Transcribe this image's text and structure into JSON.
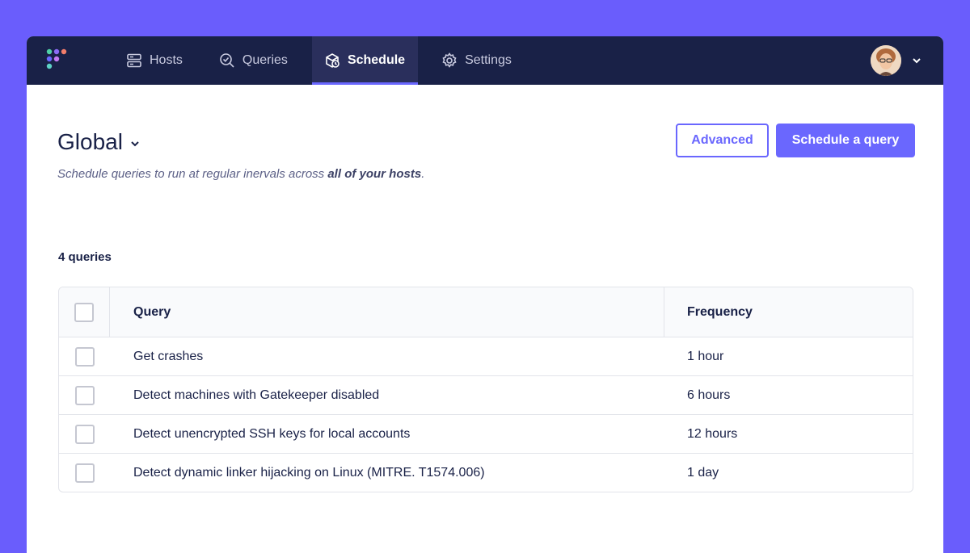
{
  "nav": {
    "items": [
      {
        "label": "Hosts",
        "icon": "hosts-icon"
      },
      {
        "label": "Queries",
        "icon": "queries-icon"
      },
      {
        "label": "Schedule",
        "icon": "schedule-icon",
        "active": true
      },
      {
        "label": "Settings",
        "icon": "settings-icon"
      }
    ]
  },
  "header": {
    "title": "Global",
    "subtitle_prefix": "Schedule queries to run at regular inervals across ",
    "subtitle_bold": "all of your hosts",
    "subtitle_suffix": "."
  },
  "buttons": {
    "advanced": "Advanced",
    "schedule": "Schedule a query"
  },
  "count_label": "4 queries",
  "table": {
    "headers": {
      "query": "Query",
      "frequency": "Frequency"
    },
    "rows": [
      {
        "query": "Get crashes",
        "frequency": "1 hour"
      },
      {
        "query": "Detect machines with Gatekeeper disabled",
        "frequency": "6 hours"
      },
      {
        "query": "Detect unencrypted SSH keys for local accounts",
        "frequency": "12 hours"
      },
      {
        "query": "Detect dynamic linker hijacking on Linux (MITRE. T1574.006)",
        "frequency": "1 day"
      }
    ]
  },
  "colors": {
    "nav_bg": "#192147",
    "accent": "#6a67fe",
    "page_bg": "#6a5dfc"
  }
}
